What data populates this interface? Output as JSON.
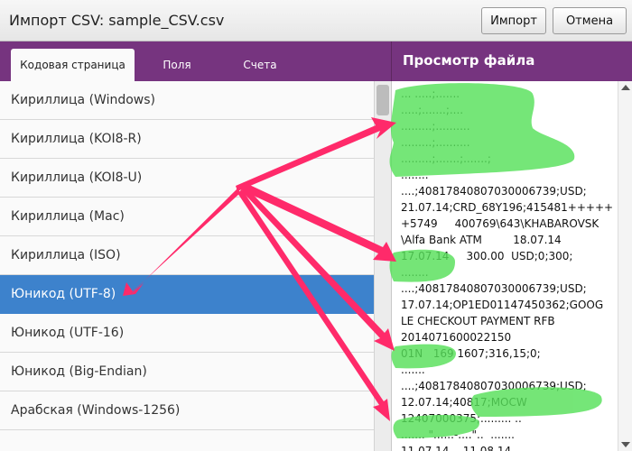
{
  "window": {
    "title": "Импорт CSV: sample_CSV.csv",
    "import_label": "Импорт",
    "cancel_label": "Отмена"
  },
  "tabs": [
    "Кодовая страница",
    "Поля",
    "Счета"
  ],
  "preview": {
    "title": "Просмотр файла",
    "text": "... .....;.......\n.....;.......;....\n.........;..........\n.........;..........\n.........;.......;.......;\n........\n....;40817840807030006739;USD;\n21.07.14;CRD_68Y196;415481+++++\n+5749     400769\\643\\KHABAROVSK\n\\Alfa Bank ATM         18.07.14\n17.07.14     300.00  USD;0;300;\n........\n....;40817840807030006739;USD;\n17.07.14;OP1ED01147450362;GOOG\nLE CHECKOUT PAYMENT RFB\n2014071600022150\n01N   169 1607;316,15;0;\n.......\n....;40817840807030006739;USD;\n12.07.14;40817;MOCW\n12407000375;......... ..\n....... \"......-....\"..  .......\n11.07.14  ..11.08.14  ........."
  },
  "encodings": [
    "Кириллица (Windows)",
    "Кириллица (KOI8-R)",
    "Кириллица (KOI8-U)",
    "Кириллица (Mac)",
    "Кириллица (ISO)",
    "Юникод (UTF-8)",
    "Юникод (UTF-16)",
    "Юникод (Big-Endian)",
    "Арабская (Windows-1256)"
  ],
  "selected_index": 5,
  "colors": {
    "accent": "#76347f",
    "selection": "#3d82cc",
    "annotation_arrow": "#ff2a6a",
    "highlight": "#57e05a"
  }
}
